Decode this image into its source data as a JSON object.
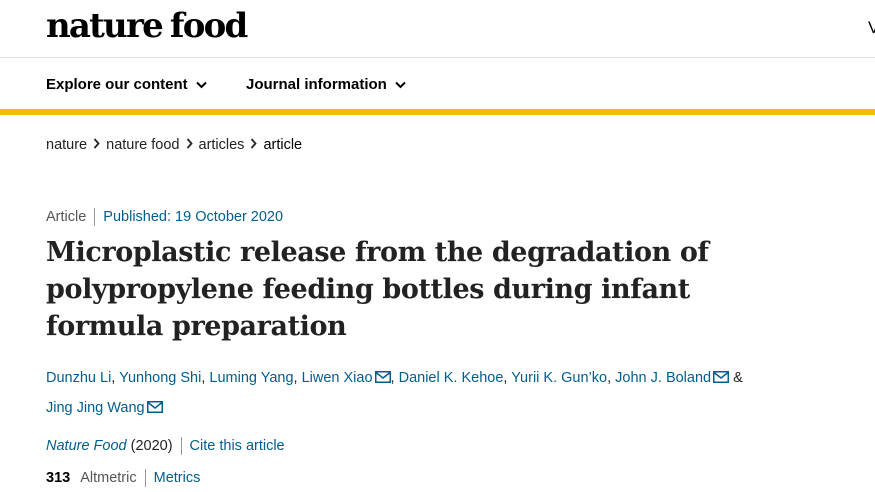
{
  "header": {
    "logo_word1": "nature",
    "logo_word2": "food",
    "edge_glyph": "V"
  },
  "nav": {
    "explore": "Explore our content",
    "journal": "Journal information"
  },
  "breadcrumb": [
    "nature",
    "nature food",
    "articles",
    "article"
  ],
  "article": {
    "type": "Article",
    "published": "Published: 19 October 2020",
    "title_lines": [
      "Microplastic release from the degradation of",
      "polypropylene feeding bottles during infant",
      "formula preparation"
    ],
    "authors": [
      "Dunzhu Li",
      "Yunhong Shi",
      "Luming Yang",
      "Liwen Xiao",
      "Daniel K. Kehoe",
      "Yurii K. Gun’ko",
      "John J. Boland",
      "Jing Jing Wang"
    ],
    "amp": "&",
    "journal": "Nature Food",
    "year": "(2020)",
    "cite": "Cite this article",
    "altmetric_count": "313",
    "altmetric_label": "Altmetric",
    "metrics_link": "Metrics"
  },
  "icons": {
    "nav_chevron": "chevron-down-icon",
    "breadcrumb_separator": "chevron-right-icon",
    "author_email": "email-icon"
  },
  "colors": {
    "accent": "#f5bc02",
    "link": "#025e8d",
    "text": "#222222"
  }
}
